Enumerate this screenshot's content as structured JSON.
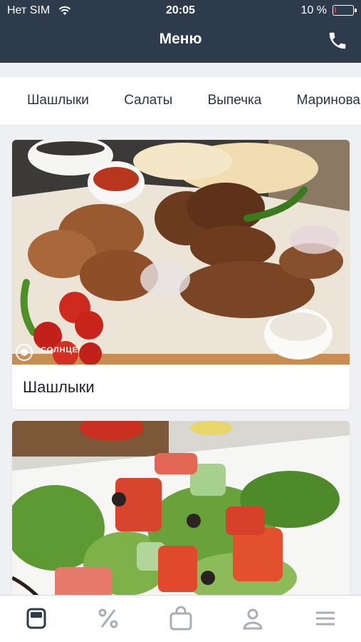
{
  "status_bar": {
    "carrier": "Нет SIM",
    "time": "20:05",
    "battery": "10 %",
    "battery_level": 0.1,
    "battery_color": "#e23b3b"
  },
  "header": {
    "title": "Меню",
    "background": "#2e3b4c",
    "action_icon": "phone-icon"
  },
  "categories": [
    "Шашлыки",
    "Салаты",
    "Выпечка",
    "Маринованное"
  ],
  "cards": [
    {
      "title": "Шашлыки",
      "brand": "СОЛНЦЕ",
      "image": "grilled-meat-photo"
    },
    {
      "title": "",
      "image": "salad-photo"
    }
  ],
  "bottom_nav": [
    {
      "icon": "menu-icon",
      "active": true
    },
    {
      "icon": "percent-icon",
      "active": false
    },
    {
      "icon": "bag-icon",
      "active": false
    },
    {
      "icon": "profile-icon",
      "active": false
    },
    {
      "icon": "hamburger-icon",
      "active": false
    }
  ]
}
